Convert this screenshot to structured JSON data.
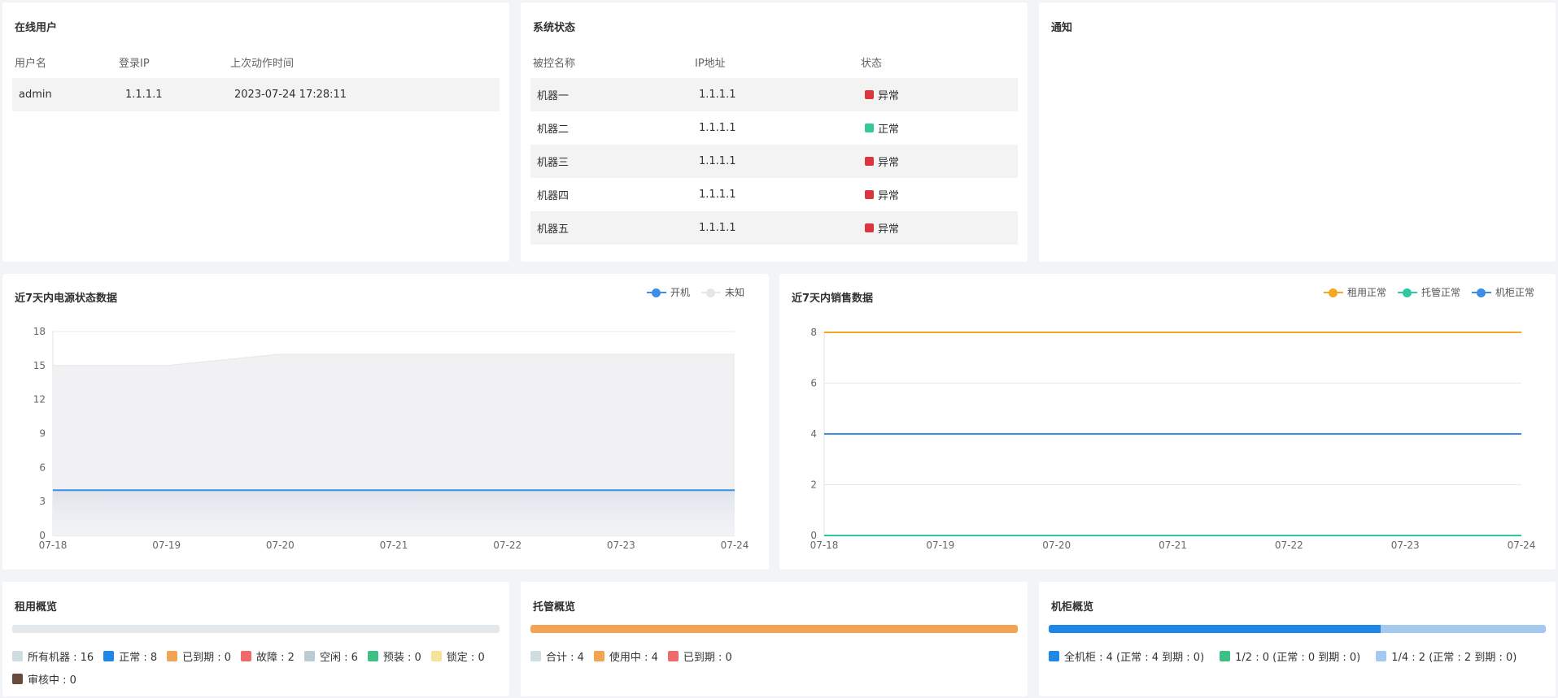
{
  "online_users": {
    "title": "在线用户",
    "columns": [
      "用户名",
      "登录IP",
      "上次动作时间"
    ],
    "rows": [
      {
        "username": "admin",
        "ip": "1.1.1.1",
        "last_action": "2023-07-24 17:28:11"
      }
    ]
  },
  "system_status": {
    "title": "系统状态",
    "columns": [
      "被控名称",
      "IP地址",
      "状态"
    ],
    "rows": [
      {
        "name": "机器一",
        "ip": "1.1.1.1",
        "status": "异常",
        "color": "#d9363e"
      },
      {
        "name": "机器二",
        "ip": "1.1.1.1",
        "status": "正常",
        "color": "#34c89a"
      },
      {
        "name": "机器三",
        "ip": "1.1.1.1",
        "status": "异常",
        "color": "#d9363e"
      },
      {
        "name": "机器四",
        "ip": "1.1.1.1",
        "status": "异常",
        "color": "#d9363e"
      },
      {
        "name": "机器五",
        "ip": "1.1.1.1",
        "status": "异常",
        "color": "#d9363e"
      }
    ]
  },
  "notice": {
    "title": "通知"
  },
  "power_chart": {
    "title": "近7天内电源状态数据",
    "legend": [
      {
        "name": "开机",
        "color": "#3a8ee6"
      },
      {
        "name": "未知",
        "color": "#e6e6e6"
      }
    ]
  },
  "sales_chart": {
    "title": "近7天内销售数据",
    "legend": [
      {
        "name": "租用正常",
        "color": "#f5a623"
      },
      {
        "name": "托管正常",
        "color": "#2ec7a0"
      },
      {
        "name": "机柜正常",
        "color": "#3a8ee6"
      }
    ]
  },
  "chart_data": [
    {
      "type": "area",
      "title": "近7天内电源状态数据",
      "categories": [
        "07-18",
        "07-19",
        "07-20",
        "07-21",
        "07-22",
        "07-23",
        "07-24"
      ],
      "ylim": [
        0,
        18
      ],
      "yticks": [
        0,
        3,
        6,
        9,
        12,
        15,
        18
      ],
      "series": [
        {
          "name": "未知",
          "color": "#e6e6e6",
          "values": [
            15,
            15,
            16,
            16,
            16,
            16,
            16
          ]
        },
        {
          "name": "开机",
          "color": "#3a8ee6",
          "values": [
            4,
            4,
            4,
            4,
            4,
            4,
            4
          ]
        }
      ],
      "legend_position": "top-right",
      "grid": true
    },
    {
      "type": "line",
      "title": "近7天内销售数据",
      "categories": [
        "07-18",
        "07-19",
        "07-20",
        "07-21",
        "07-22",
        "07-23",
        "07-24"
      ],
      "ylim": [
        0,
        8
      ],
      "yticks": [
        0,
        2,
        4,
        6,
        8
      ],
      "series": [
        {
          "name": "租用正常",
          "color": "#f5a623",
          "values": [
            8,
            8,
            8,
            8,
            8,
            8,
            8
          ]
        },
        {
          "name": "托管正常",
          "color": "#2ec7a0",
          "values": [
            0,
            0,
            0,
            0,
            0,
            0,
            0
          ]
        },
        {
          "name": "机柜正常",
          "color": "#3a8ee6",
          "values": [
            4,
            4,
            4,
            4,
            4,
            4,
            4
          ]
        }
      ],
      "legend_position": "top-right",
      "grid": true
    }
  ],
  "rent_overview": {
    "title": "租用概览",
    "items": [
      {
        "label": "所有机器 : 16",
        "color": "#cfdce2"
      },
      {
        "label": "正常 : 8",
        "color": "#1f87e5"
      },
      {
        "label": "已到期 : 0",
        "color": "#f3a453"
      },
      {
        "label": "故障 : 2",
        "color": "#ef6b6b"
      },
      {
        "label": "空闲 : 6",
        "color": "#bccbd3"
      },
      {
        "label": "预装 : 0",
        "color": "#3dbf86"
      },
      {
        "label": "锁定 : 0",
        "color": "#f6e39b"
      },
      {
        "label": "审核中 : 0",
        "color": "#6b4a3e"
      }
    ]
  },
  "hosting_overview": {
    "title": "托管概览",
    "bar_fill_fraction": 1.0,
    "bar_color": "#f3a453",
    "items": [
      {
        "label": "合计 : 4",
        "color": "#cfdce2"
      },
      {
        "label": "使用中 : 4",
        "color": "#f3a453"
      },
      {
        "label": "已到期 : 0",
        "color": "#ef6b6b"
      }
    ]
  },
  "cabinet_overview": {
    "title": "机柜概览",
    "bar_fill_fraction": 0.667,
    "items": [
      {
        "label": "全机柜 : 4 (正常 : 4 到期 : 0)",
        "color": "#1f87e5"
      },
      {
        "label": "1/2 : 0 (正常 : 0 到期 : 0)",
        "color": "#3dbf86"
      },
      {
        "label": "1/4 : 2 (正常 : 2 到期 : 0)",
        "color": "#a5c9ee"
      }
    ]
  }
}
